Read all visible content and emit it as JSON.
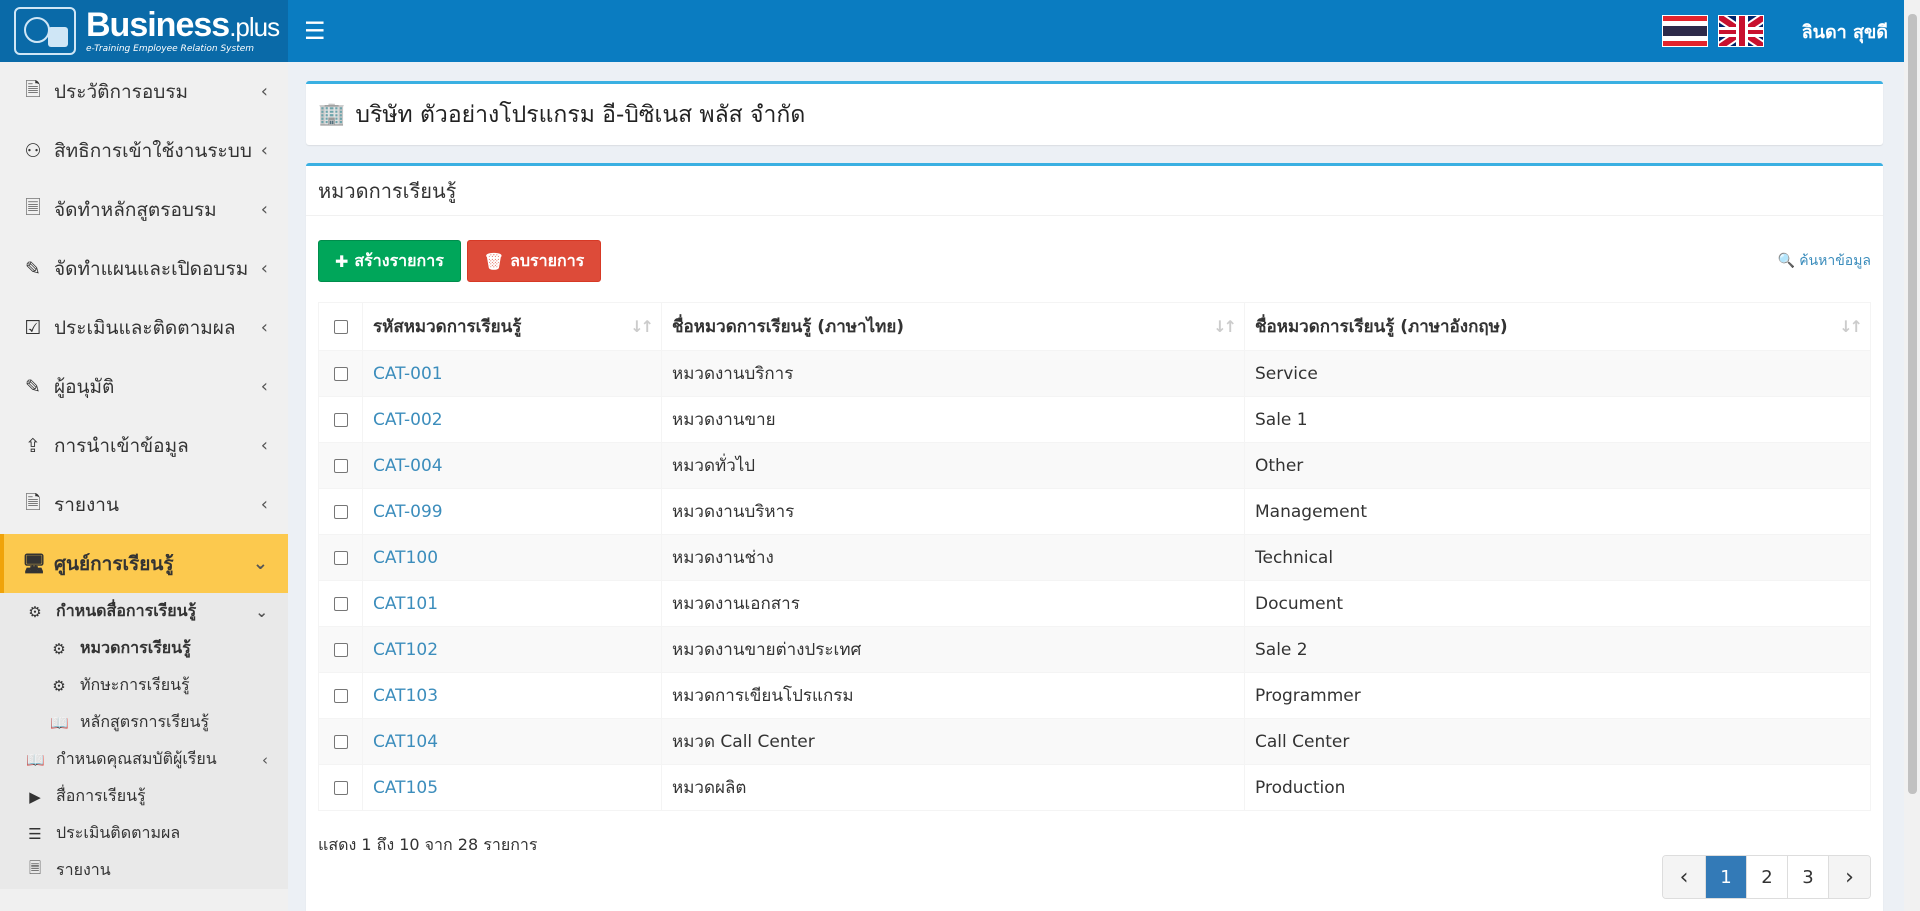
{
  "header": {
    "brand_name": "Business",
    "brand_suffix": ".plus",
    "brand_tagline": "e-Training Employee Relation System",
    "username": "ลินดา สุขดี"
  },
  "sidebar": {
    "items": [
      {
        "label": "ประวัติการอบรม",
        "icon": "document-icon"
      },
      {
        "label": "สิทธิการเข้าใช้งานระบบ",
        "icon": "users-icon"
      },
      {
        "label": "จัดทำหลักสูตรอบรม",
        "icon": "file-icon"
      },
      {
        "label": "จัดทำแผนและเปิดอบรม",
        "icon": "edit-icon"
      },
      {
        "label": "ประเมินและติดตามผล",
        "icon": "check-square-icon"
      },
      {
        "label": "ผู้อนุมัติ",
        "icon": "edit-icon"
      },
      {
        "label": "การนำเข้าข้อมูล",
        "icon": "upload-icon"
      },
      {
        "label": "รายงาน",
        "icon": "pdf-icon"
      },
      {
        "label": "ศูนย์การเรียนรู้",
        "icon": "monitor-icon"
      }
    ],
    "sub": {
      "media_settings": "กำหนดสื่อการเรียนรู้",
      "category": "หมวดการเรียนรู้",
      "skill": "ทักษะการเรียนรู้",
      "course": "หลักสูตรการเรียนรู้",
      "learner_qual": "กำหนดคุณสมบัติผู้เรียน",
      "media": "สื่อการเรียนรู้",
      "evaluate": "ประเมินติดตามผล",
      "report": "รายงาน"
    }
  },
  "company": {
    "name": "บริษัท ตัวอย่างโปรแกรม อี-บิซิเนส พลัส จำกัด"
  },
  "main": {
    "title": "หมวดการเรียนรู้",
    "create_label": "สร้างรายการ",
    "delete_label": "ลบรายการ",
    "search_label": "ค้นหาข้อมูล",
    "columns": [
      "รหัสหมวดการเรียนรู้",
      "ชื่อหมวดการเรียนรู้ (ภาษาไทย)",
      "ชื่อหมวดการเรียนรู้ (ภาษาอังกฤษ)"
    ],
    "rows": [
      {
        "code": "CAT-001",
        "th": "หมวดงานบริการ",
        "en": "Service"
      },
      {
        "code": "CAT-002",
        "th": "หมวดงานขาย",
        "en": "Sale 1"
      },
      {
        "code": "CAT-004",
        "th": "หมวดทั่วไป",
        "en": "Other"
      },
      {
        "code": "CAT-099",
        "th": "หมวดงานบริหาร",
        "en": "Management"
      },
      {
        "code": "CAT100",
        "th": "หมวดงานช่าง",
        "en": "Technical"
      },
      {
        "code": "CAT101",
        "th": "หมวดงานเอกสาร",
        "en": "Document"
      },
      {
        "code": "CAT102",
        "th": "หมวดงานขายต่างประเทศ",
        "en": "Sale 2"
      },
      {
        "code": "CAT103",
        "th": "หมวดการเขียนโปรแกรม",
        "en": "Programmer"
      },
      {
        "code": "CAT104",
        "th": "หมวด Call Center",
        "en": "Call Center"
      },
      {
        "code": "CAT105",
        "th": "หมวดผลิต",
        "en": "Production"
      }
    ],
    "info": "แสดง 1 ถึง 10 จาก 28 รายการ",
    "pages": [
      "1",
      "2",
      "3"
    ],
    "current_page": "1"
  }
}
